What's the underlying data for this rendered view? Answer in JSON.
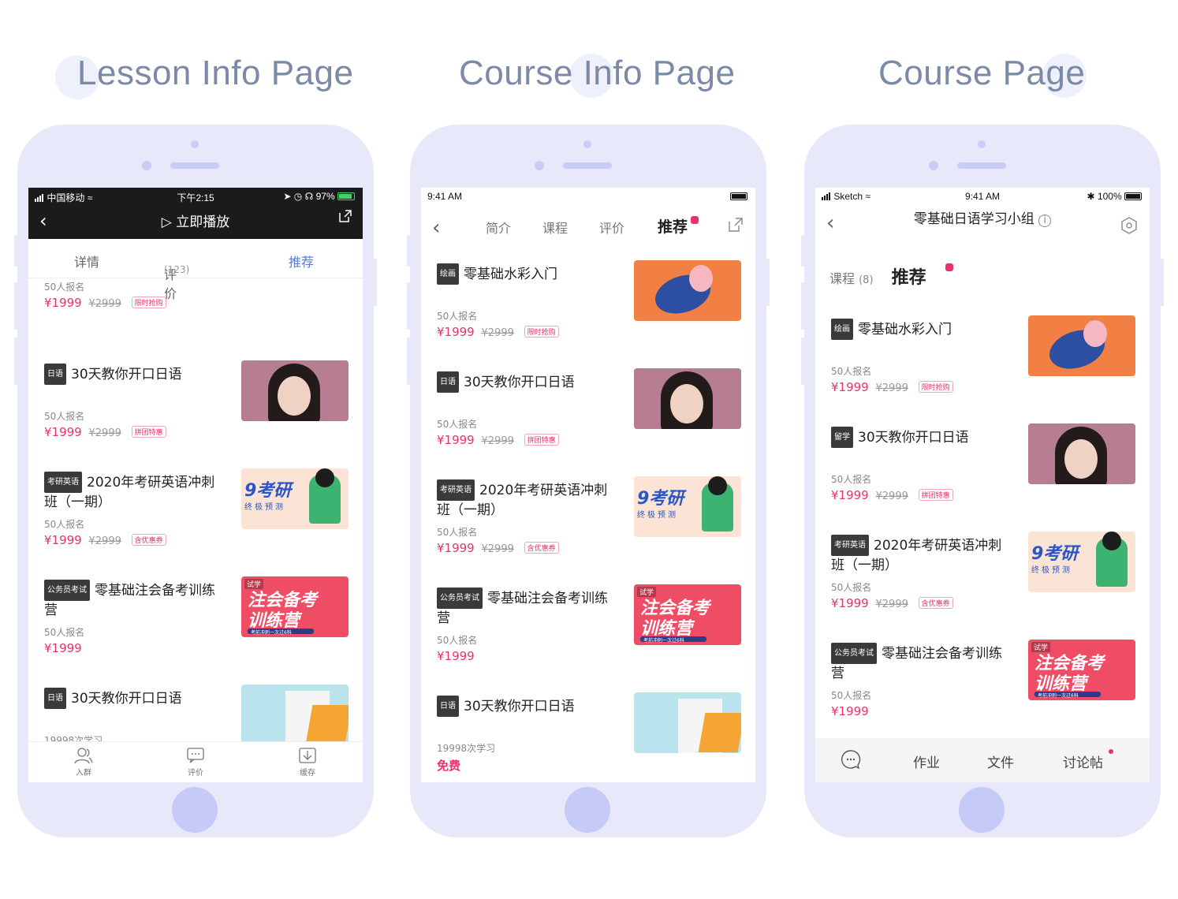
{
  "titles": [
    "Lesson Info Page",
    "Course Info Page",
    "Course Page"
  ],
  "colors": {
    "accent": "#e8336b",
    "active_tab": "#4a7df0",
    "phone_frame": "#e7e9fb"
  },
  "phone1": {
    "status": {
      "carrier": "中国移动",
      "time": "下午2:15",
      "battery": "97%"
    },
    "play_label": "立即播放",
    "tabs": {
      "detail": "详情",
      "review": "评价",
      "review_count": "(123)",
      "recommend": "推荐"
    },
    "items": [
      {
        "badge": "",
        "title": "",
        "enrolled": "50人报名",
        "price": "¥1999",
        "orig": "¥2999",
        "tag": "限时抢购",
        "thumb": "paint"
      },
      {
        "badge": "日语",
        "title": "30天教你开口日语",
        "enrolled": "50人报名",
        "price": "¥1999",
        "orig": "¥2999",
        "tag": "拼团特惠",
        "thumb": "girl"
      },
      {
        "badge": "考研英语",
        "title": "2020年考研英语冲刺班（一期）",
        "enrolled": "50人报名",
        "price": "¥1999",
        "orig": "¥2999",
        "tag": "含优惠券",
        "thumb": "exam"
      },
      {
        "badge": "公务员考试",
        "title": "零基础注会备考训练营",
        "enrolled": "50人报名",
        "price": "¥1999",
        "orig": "",
        "tag": "",
        "thumb": "civil"
      },
      {
        "badge": "日语",
        "title": "30天教你开口日语",
        "enrolled": "19998次学习",
        "price": "",
        "orig": "",
        "tag": "",
        "thumb": "build"
      }
    ],
    "bottom": {
      "join": "入群",
      "review": "评价",
      "cache": "缓存"
    }
  },
  "phone2": {
    "status": {
      "time": "9:41 AM"
    },
    "tabs": {
      "intro": "简介",
      "course": "课程",
      "review": "评价",
      "recommend": "推荐"
    },
    "items": [
      {
        "badge": "绘画",
        "title": "零基础水彩入门",
        "enrolled": "50人报名",
        "price": "¥1999",
        "orig": "¥2999",
        "tag": "限时抢购",
        "thumb": "paint"
      },
      {
        "badge": "日语",
        "title": "30天教你开口日语",
        "enrolled": "50人报名",
        "price": "¥1999",
        "orig": "¥2999",
        "tag": "拼团特惠",
        "thumb": "girl"
      },
      {
        "badge": "考研英语",
        "title": "2020年考研英语冲刺班（一期）",
        "enrolled": "50人报名",
        "price": "¥1999",
        "orig": "¥2999",
        "tag": "含优惠券",
        "thumb": "exam"
      },
      {
        "badge": "公务员考试",
        "title": "零基础注会备考训练营",
        "enrolled": "50人报名",
        "price": "¥1999",
        "orig": "",
        "tag": "",
        "thumb": "civil"
      },
      {
        "badge": "日语",
        "title": "30天教你开口日语",
        "enrolled": "19998次学习",
        "price": "",
        "orig": "",
        "tag": "",
        "free": "免费",
        "thumb": "build"
      }
    ]
  },
  "phone3": {
    "status": {
      "carrier": "Sketch",
      "time": "9:41 AM",
      "battery": "100%"
    },
    "group_title": "零基础日语学习小组",
    "tabs": {
      "course": "课程",
      "course_count": "(8)",
      "recommend": "推荐"
    },
    "items": [
      {
        "badge": "绘画",
        "title": "零基础水彩入门",
        "enrolled": "50人报名",
        "price": "¥1999",
        "orig": "¥2999",
        "tag": "限时抢购",
        "thumb": "paint"
      },
      {
        "badge": "留学",
        "title": "30天教你开口日语",
        "enrolled": "50人报名",
        "price": "¥1999",
        "orig": "¥2999",
        "tag": "拼团特惠",
        "thumb": "girl"
      },
      {
        "badge": "考研英语",
        "title": "2020年考研英语冲刺班（一期）",
        "enrolled": "50人报名",
        "price": "¥1999",
        "orig": "¥2999",
        "tag": "含优惠券",
        "thumb": "exam"
      },
      {
        "badge": "公务员考试",
        "title": "零基础注会备考训练营",
        "enrolled": "50人报名",
        "price": "¥1999",
        "orig": "",
        "tag": "",
        "thumb": "civil"
      }
    ],
    "bottom": {
      "homework": "作业",
      "files": "文件",
      "discussion": "讨论帖"
    }
  },
  "thumb_text": {
    "exam_big": "9考研",
    "exam_small": "终极预测",
    "civil_trial": "试学",
    "civil_l1": "注会备考",
    "civil_l2": "训练营",
    "civil_sub": "考前冲刺一次过6科"
  }
}
